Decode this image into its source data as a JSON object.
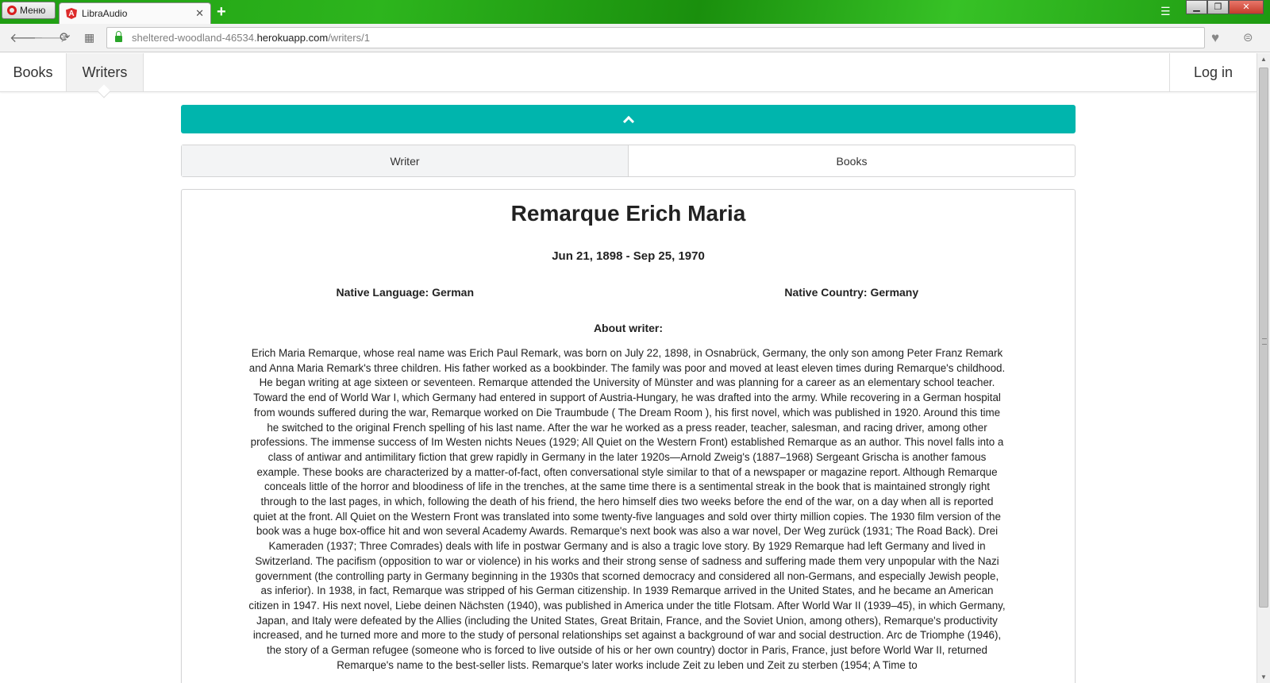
{
  "browser": {
    "menu_label": "Меню",
    "tab_title": "LibraAudio",
    "tab_close": "✕",
    "new_tab": "+",
    "url_host_prefix": "sheltered-woodland-46534.",
    "url_host_domain": "herokuapp.com",
    "url_path": "/writers/1",
    "accent_color": "#2db51d"
  },
  "nav": {
    "books": "Books",
    "writers": "Writers",
    "login": "Log in"
  },
  "subtabs": {
    "writer": "Writer",
    "books": "Books"
  },
  "writer": {
    "name": "Remarque Erich Maria",
    "dates": "Jun 21, 1898 - Sep 25, 1970",
    "native_language": "Native Language: German",
    "native_country": "Native Country: Germany",
    "about_heading": "About writer:",
    "about_text": "Erich Maria Remarque, whose real name was Erich Paul Remark, was born on July 22, 1898, in Osnabrück, Germany, the only son among Peter Franz Remark and Anna Maria Remark's three children. His father worked as a bookbinder. The family was poor and moved at least eleven times during Remarque's childhood. He began writing at age sixteen or seventeen. Remarque attended the University of Münster and was planning for a career as an elementary school teacher. Toward the end of World War I, which Germany had entered in support of Austria-Hungary, he was drafted into the army. While recovering in a German hospital from wounds suffered during the war, Remarque worked on Die Traumbude ( The Dream Room ), his first novel, which was published in 1920. Around this time he switched to the original French spelling of his last name. After the war he worked as a press reader, teacher, salesman, and racing driver, among other professions. The immense success of Im Westen nichts Neues (1929; All Quiet on the Western Front) established Remarque as an author. This novel falls into a class of antiwar and antimilitary fiction that grew rapidly in Germany in the later 1920s—Arnold Zweig's (1887–1968) Sergeant Grischa is another famous example. These books are characterized by a matter-of-fact, often conversational style similar to that of a newspaper or magazine report. Although Remarque conceals little of the horror and bloodiness of life in the trenches, at the same time there is a sentimental streak in the book that is maintained strongly right through to the last pages, in which, following the death of his friend, the hero himself dies two weeks before the end of the war, on a day when all is reported quiet at the front. All Quiet on the Western Front was translated into some twenty-five languages and sold over thirty million copies. The 1930 film version of the book was a huge box-office hit and won several Academy Awards. Remarque's next book was also a war novel, Der Weg zurück (1931; The Road Back). Drei Kameraden (1937; Three Comrades) deals with life in postwar Germany and is also a tragic love story. By 1929 Remarque had left Germany and lived in Switzerland. The pacifism (opposition to war or violence) in his works and their strong sense of sadness and suffering made them very unpopular with the Nazi government (the controlling party in Germany beginning in the 1930s that scorned democracy and considered all non-Germans, and especially Jewish people, as inferior). In 1938, in fact, Remarque was stripped of his German citizenship. In 1939 Remarque arrived in the United States, and he became an American citizen in 1947. His next novel, Liebe deinen Nächsten (1940), was published in America under the title Flotsam. After World War II (1939–45), in which Germany, Japan, and Italy were defeated by the Allies (including the United States, Great Britain, France, and the Soviet Union, among others), Remarque's productivity increased, and he turned more and more to the study of personal relationships set against a background of war and social destruction. Arc de Triomphe (1946), the story of a German refugee (someone who is forced to live outside of his or her own country) doctor in Paris, France, just before World War II, returned Remarque's name to the best-seller lists. Remarque's later works include Zeit zu leben und Zeit zu sterben (1954; A Time to"
  },
  "theme": {
    "collapse_bar_color": "#00b5ad"
  }
}
